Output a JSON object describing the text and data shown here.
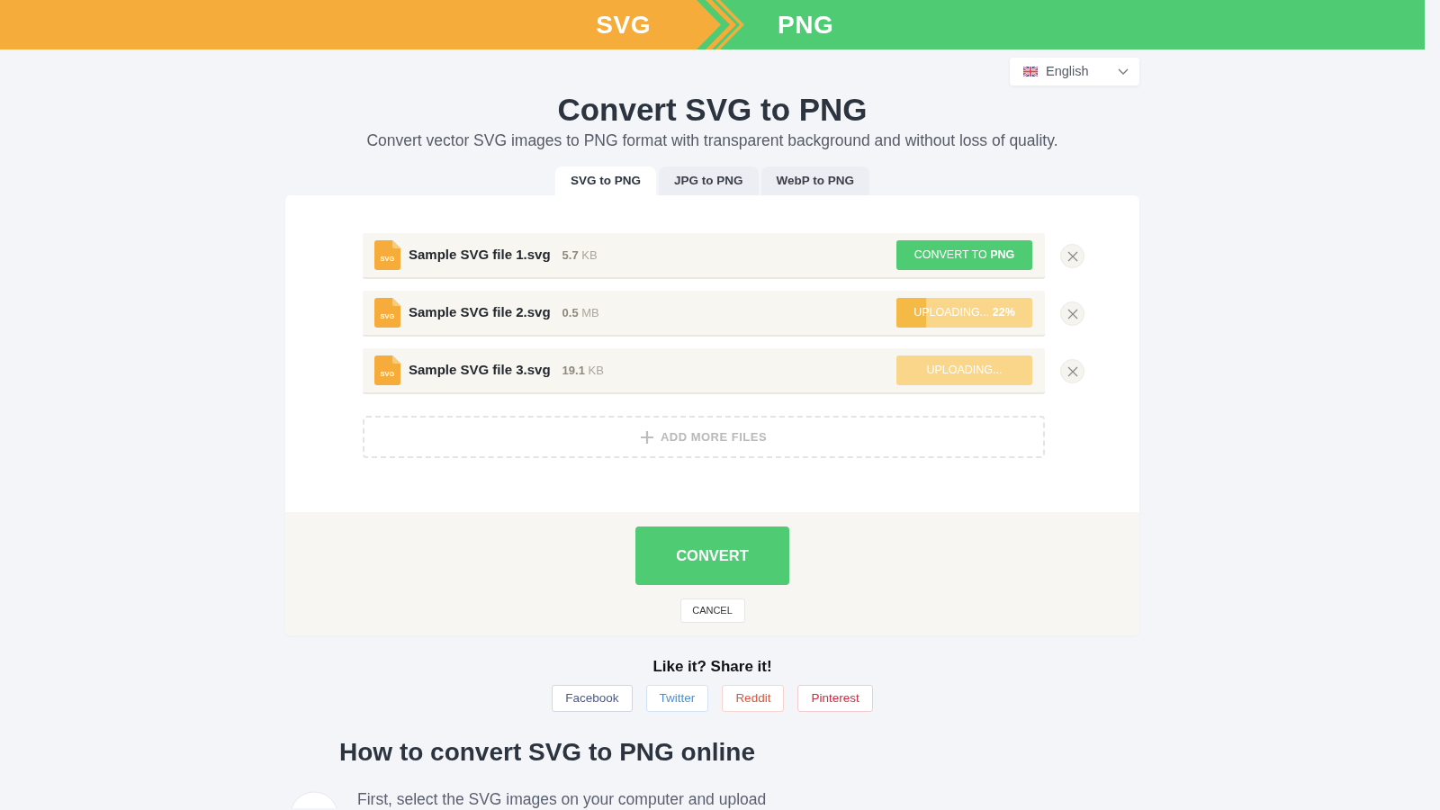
{
  "banner": {
    "source": "SVG",
    "target": "PNG"
  },
  "language": {
    "label": "English"
  },
  "title": "Convert SVG to PNG",
  "subtitle": "Convert vector SVG images to PNG format with transparent background and without loss of quality.",
  "tabs": [
    {
      "label": "SVG to PNG",
      "selected": true
    },
    {
      "label": "JPG to PNG",
      "selected": false
    },
    {
      "label": "WebP to PNG",
      "selected": false
    }
  ],
  "files": [
    {
      "icon_label": "SVG",
      "name": "Sample SVG file 1.svg",
      "size": "**5.7** KB",
      "kind": "ready",
      "action": "CONVERT TO **PNG**"
    },
    {
      "icon_label": "SVG",
      "name": "Sample SVG file 2.svg",
      "size": "**0.5** MB",
      "kind": "uploading",
      "action": "UPLOADING... **22%**",
      "level": 0.22
    },
    {
      "icon_label": "SVG",
      "name": "Sample SVG file 3.svg",
      "size": "**19.1** KB",
      "kind": "uploading",
      "action": "UPLOADING..."
    }
  ],
  "add_more": "ADD MORE FILES",
  "convert_button": "CONVERT",
  "cancel_button": "CANCEL",
  "share": {
    "title": "Like it? Share it!",
    "links": [
      {
        "label": "Facebook",
        "color": "#4b5a86"
      },
      {
        "label": "Twitter",
        "color": "#4a90d9"
      },
      {
        "label": "Reddit",
        "color": "#e0533a"
      },
      {
        "label": "Pinterest",
        "color": "#cf2a40"
      }
    ]
  },
  "howto": {
    "title": "How to convert SVG to PNG online",
    "steps": [
      {
        "text": "First, select the SVG images on your computer and upload"
      }
    ]
  }
}
